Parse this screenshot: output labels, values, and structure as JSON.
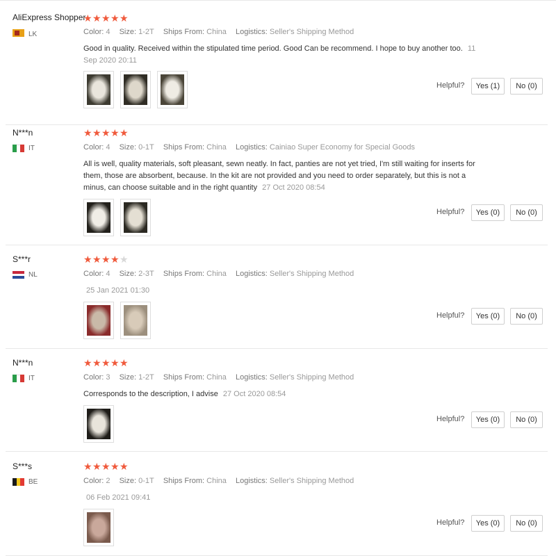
{
  "labels": {
    "color": "Color:",
    "size": "Size:",
    "ships_from": "Ships From:",
    "logistics": "Logistics:",
    "helpful": "Helpful?"
  },
  "colors": {
    "star": "#f05a3c",
    "star_empty": "#d8d8d8",
    "separator": "#e8e8e8"
  },
  "reviews": [
    {
      "user": "AliExpress Shopper",
      "flag_icon": "sri-lanka-flag-icon",
      "country": "LK",
      "rating": 5,
      "color": "4",
      "size": "1-2T",
      "ships_from": "China",
      "logistics": "Seller's Shipping Method",
      "text": "Good in quality. Received within the stipulated time period. Good Can be recommend. I hope to buy another too.",
      "date": "11 Sep 2020 20:11",
      "photo_count": 3,
      "yes": "Yes (1)",
      "no": "No (0)"
    },
    {
      "user": "N***n",
      "flag_icon": "italy-flag-icon",
      "country": "IT",
      "rating": 5,
      "color": "4",
      "size": "0-1T",
      "ships_from": "China",
      "logistics": "Cainiao Super Economy for Special Goods",
      "text": "All is well, quality materials, soft pleasant, sewn neatly. In fact, panties are not yet tried, I'm still waiting for inserts for them, those are absorbent, because. In the kit are not provided and you need to order separately, but this is not a minus, can choose suitable and in the right quantity",
      "date": "27 Oct 2020 08:54",
      "photo_count": 2,
      "yes": "Yes (0)",
      "no": "No (0)"
    },
    {
      "user": "S***r",
      "flag_icon": "netherlands-flag-icon",
      "country": "NL",
      "rating": 4,
      "color": "4",
      "size": "2-3T",
      "ships_from": "China",
      "logistics": "Seller's Shipping Method",
      "text": "",
      "date": "25 Jan 2021 01:30",
      "photo_count": 2,
      "yes": "Yes (0)",
      "no": "No (0)"
    },
    {
      "user": "N***n",
      "flag_icon": "italy-flag-icon",
      "country": "IT",
      "rating": 5,
      "color": "3",
      "size": "1-2T",
      "ships_from": "China",
      "logistics": "Seller's Shipping Method",
      "text": "Corresponds to the description, I advise",
      "date": "27 Oct 2020 08:54",
      "photo_count": 1,
      "yes": "Yes (0)",
      "no": "No (0)"
    },
    {
      "user": "S***s",
      "flag_icon": "belgium-flag-icon",
      "country": "BE",
      "rating": 5,
      "color": "2",
      "size": "0-1T",
      "ships_from": "China",
      "logistics": "Seller's Shipping Method",
      "text": "",
      "date": "06 Feb 2021 09:41",
      "photo_count": 1,
      "yes": "Yes (0)",
      "no": "No (0)"
    }
  ]
}
